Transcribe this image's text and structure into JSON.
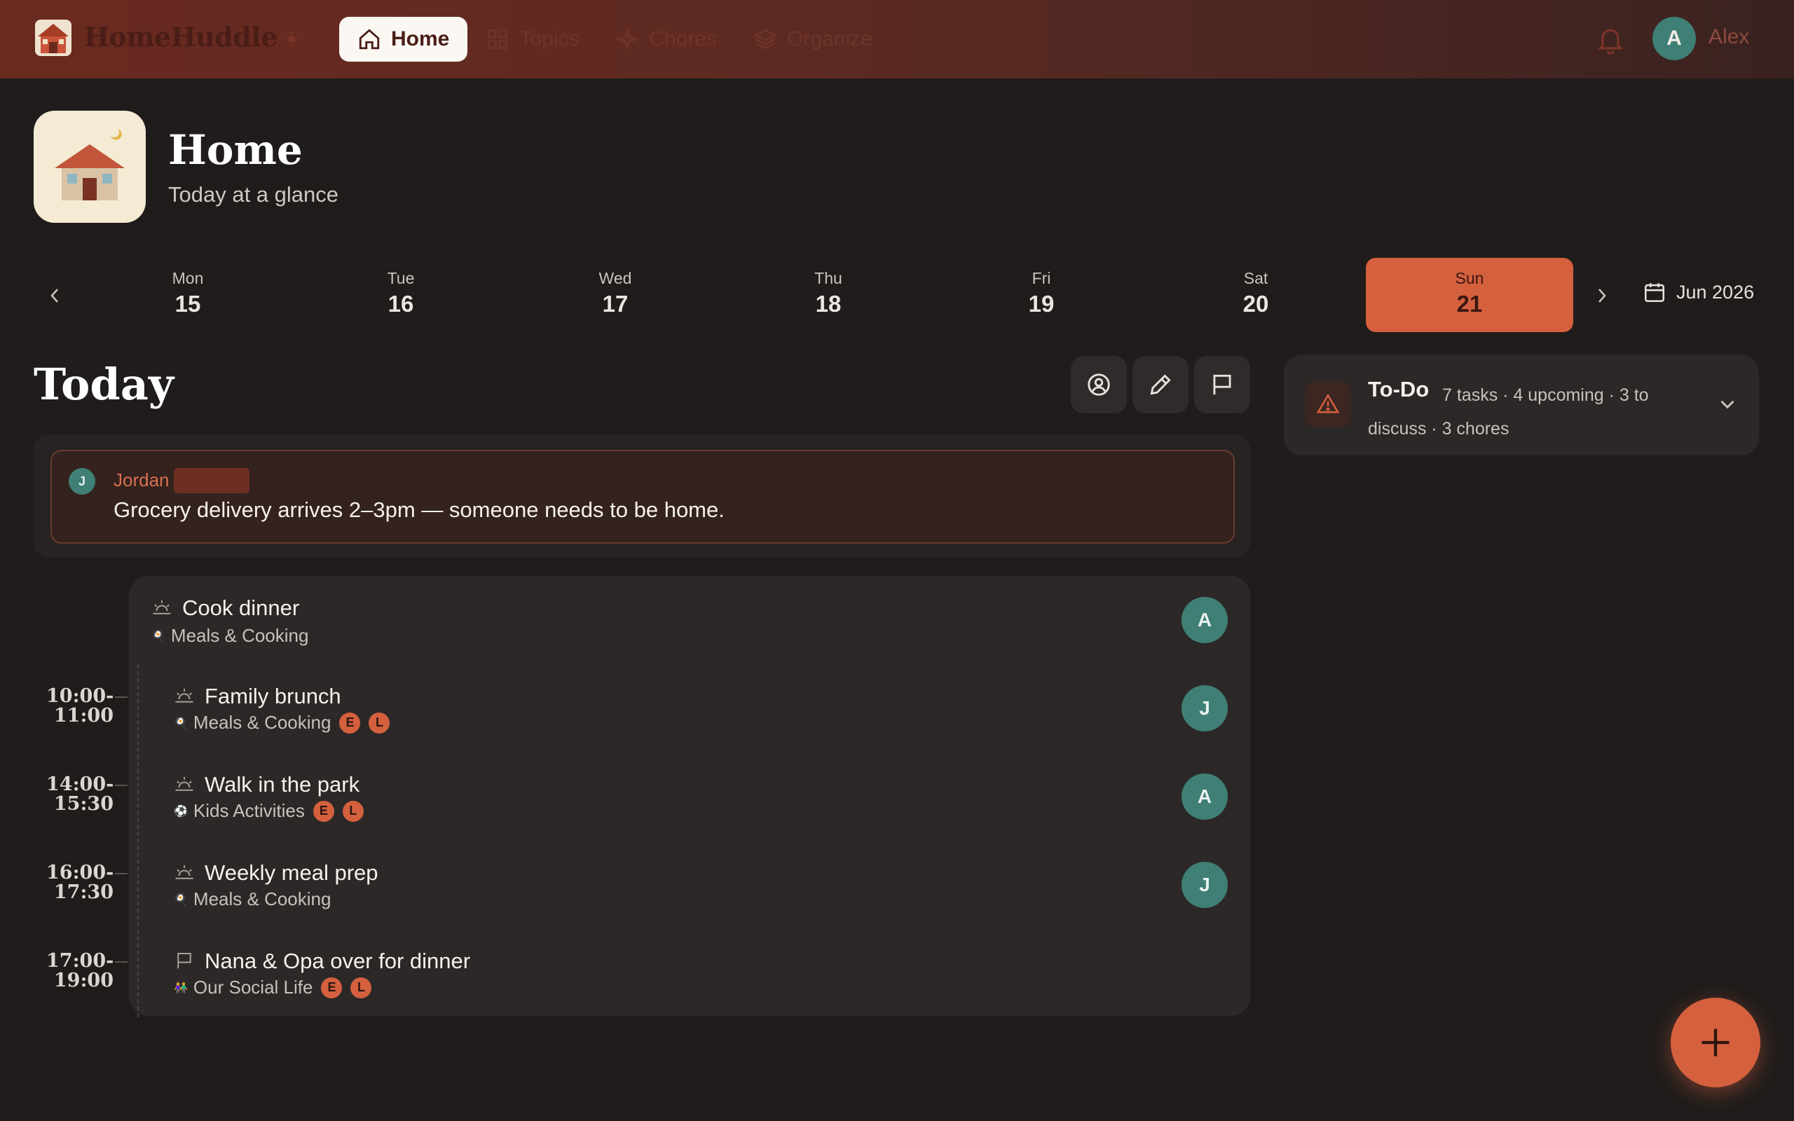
{
  "app": {
    "name": "HomeHuddle"
  },
  "nav": {
    "items": [
      {
        "label": "Home",
        "icon": "home-icon",
        "active": true
      },
      {
        "label": "Topics",
        "icon": "grid-icon",
        "active": false
      },
      {
        "label": "Chores",
        "icon": "sparkle-icon",
        "active": false
      },
      {
        "label": "Organize",
        "icon": "layers-icon",
        "active": false
      }
    ]
  },
  "user": {
    "initial": "A",
    "name": "Alex"
  },
  "header": {
    "title": "Home",
    "subtitle": "Today at a glance"
  },
  "week": {
    "days": [
      {
        "name": "Mon",
        "date": "15"
      },
      {
        "name": "Tue",
        "date": "16"
      },
      {
        "name": "Wed",
        "date": "17"
      },
      {
        "name": "Thu",
        "date": "18"
      },
      {
        "name": "Fri",
        "date": "19"
      },
      {
        "name": "Sat",
        "date": "20"
      },
      {
        "name": "Sun",
        "date": "21",
        "selected": true
      }
    ],
    "month_label": "Jun 2026"
  },
  "today": {
    "title": "Today",
    "note": {
      "author_initial": "J",
      "author": "Jordan",
      "text": "Grocery delivery arrives 2–3pm — someone needs to be home."
    },
    "events": [
      {
        "time_start": "",
        "time_end": "",
        "title": "Cook dinner",
        "category": "Meals & Cooking",
        "category_emoji": "🍳",
        "chips": [],
        "assignee": "A",
        "icon": "sunrise-icon"
      },
      {
        "time_start": "10:00-",
        "time_end": "11:00",
        "title": "Family brunch",
        "category": "Meals & Cooking",
        "category_emoji": "🍳",
        "chips": [
          "E",
          "L"
        ],
        "assignee": "J",
        "icon": "sunrise-icon"
      },
      {
        "time_start": "14:00-",
        "time_end": "15:30",
        "title": "Walk in the park",
        "category": "Kids Activities",
        "category_emoji": "⚽",
        "chips": [
          "E",
          "L"
        ],
        "assignee": "A",
        "icon": "sunrise-icon"
      },
      {
        "time_start": "16:00-",
        "time_end": "17:30",
        "title": "Weekly meal prep",
        "category": "Meals & Cooking",
        "category_emoji": "🍳",
        "chips": [],
        "assignee": "J",
        "icon": "sunrise-icon"
      },
      {
        "time_start": "17:00-",
        "time_end": "19:00",
        "title": "Nana & Opa over for dinner",
        "category": "Our Social Life",
        "category_emoji": "👫",
        "chips": [
          "E",
          "L"
        ],
        "assignee": "",
        "icon": "flag-icon"
      }
    ]
  },
  "todo": {
    "title": "To-Do",
    "summary": "7 tasks · 4 upcoming · 3 to discuss · 3 chores"
  },
  "colors": {
    "accent": "#d4603e",
    "teal": "#3f7f75",
    "background": "#1f1c1b",
    "card": "#2b2827"
  }
}
